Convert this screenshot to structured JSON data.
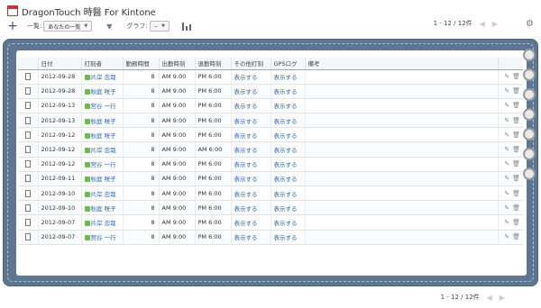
{
  "app": {
    "title": "DragonTouch 時醫 For Kintone"
  },
  "toolbar": {
    "view_label": "一覧:",
    "view_value": "あなたの一覧",
    "graph_label": "グラフ:",
    "graph_value": "--"
  },
  "pagination": {
    "top": "1 - 12 / 12件",
    "bottom": "1 - 12 / 12件"
  },
  "table": {
    "headers": [
      "日付",
      "打刻者",
      "勤務時間",
      "出勤時刻",
      "退勤時刻",
      "その他打刻",
      "GPSログ",
      "備考"
    ],
    "link_text": "表示する",
    "rows": [
      {
        "date": "2012-09-28",
        "user": "片岸 忠哉",
        "hours": "8",
        "in": "AM 9:00",
        "out": "PM 6:00"
      },
      {
        "date": "2012-09-28",
        "user": "秋庭 咲子",
        "hours": "8",
        "in": "AM 9:00",
        "out": "PM 6:00"
      },
      {
        "date": "2012-09-13",
        "user": "宮谷 一行",
        "hours": "8",
        "in": "AM 9:00",
        "out": "PM 6:00"
      },
      {
        "date": "2012-09-13",
        "user": "秋庭 咲子",
        "hours": "8",
        "in": "AM 9:00",
        "out": "PM 6:00"
      },
      {
        "date": "2012-09-12",
        "user": "秋庭 咲子",
        "hours": "8",
        "in": "AM 9:00",
        "out": "PM 6:00"
      },
      {
        "date": "2012-09-12",
        "user": "片岸 忠哉",
        "hours": "8",
        "in": "AM 9:00",
        "out": "AM 6:00"
      },
      {
        "date": "2012-09-12",
        "user": "宮谷 一行",
        "hours": "8",
        "in": "AM 9:00",
        "out": "PM 6:00"
      },
      {
        "date": "2012-09-11",
        "user": "秋庭 咲子",
        "hours": "8",
        "in": "AM 9:00",
        "out": "PM 6:00"
      },
      {
        "date": "2012-09-10",
        "user": "片岸 忠哉",
        "hours": "8",
        "in": "AM 9:00",
        "out": "PM 6:00"
      },
      {
        "date": "2012-09-10",
        "user": "秋庭 咲子",
        "hours": "8",
        "in": "AM 9:00",
        "out": "PM 6:00"
      },
      {
        "date": "2012-09-07",
        "user": "片岸 忠哉",
        "hours": "8",
        "in": "AM 9:00",
        "out": "PM 6:00"
      },
      {
        "date": "2012-09-07",
        "user": "宮谷 一行",
        "hours": "8",
        "in": "AM 9:00",
        "out": "PM 6:00"
      }
    ]
  },
  "icons": {
    "app": "calendar-icon",
    "add": "plus-icon",
    "filter": "funnel-icon",
    "graph": "bar-chart-icon",
    "settings": "gear-icon",
    "record": "document-icon",
    "edit": "edit-icon",
    "delete": "trash-icon"
  },
  "colors": {
    "binder": "#5d7792",
    "link": "#2b65b1",
    "user_badge": "#6dbb4f",
    "title_accent": "#cc3333"
  }
}
